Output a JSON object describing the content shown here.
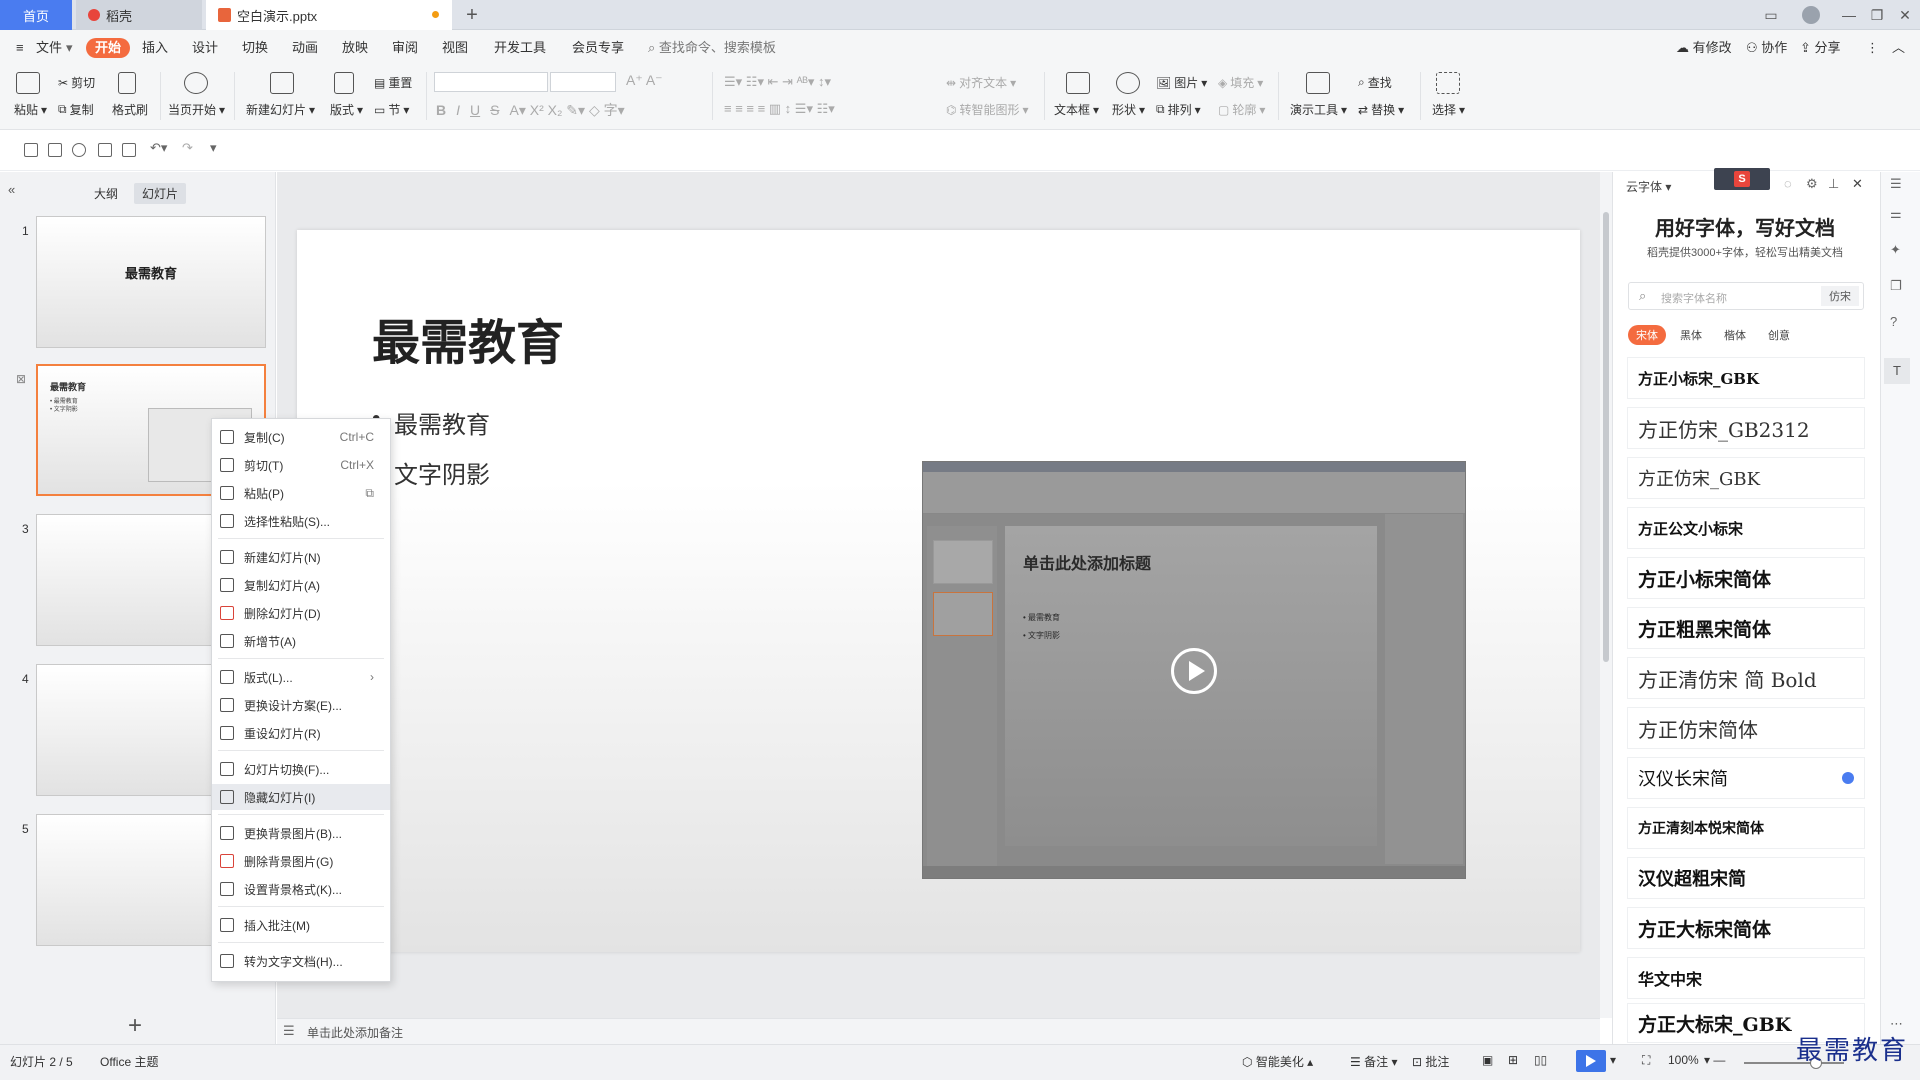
{
  "tabs": {
    "home": "首页",
    "daoke": "稻壳",
    "doc": "空白演示.pptx"
  },
  "menu": [
    "文件",
    "开始",
    "插入",
    "设计",
    "切换",
    "动画",
    "放映",
    "审阅",
    "视图",
    "开发工具",
    "会员专享"
  ],
  "search_placeholder": "查找命令、搜索模板",
  "top_right": {
    "modified": "有修改",
    "collab": "协作",
    "share": "分享"
  },
  "ribbon": {
    "paste": "粘贴",
    "cut": "剪切",
    "copy": "复制",
    "format_painter": "格式刷",
    "from_current": "当页开始",
    "new_slide": "新建幻灯片",
    "layout": "版式",
    "reset": "重置",
    "section": "节",
    "align_text": "对齐文本",
    "smart_shape": "转智能图形",
    "textbox": "文本框",
    "shape": "形状",
    "picture": "图片",
    "arrange": "排列",
    "fill": "填充",
    "outline": "轮廓",
    "present_tools": "演示工具",
    "find": "查找",
    "replace": "替换",
    "select": "选择"
  },
  "left_panel": {
    "outline_tab": "大纲",
    "slides_tab": "幻灯片",
    "slide_nums": [
      "1",
      "2",
      "3",
      "4",
      "5"
    ],
    "thumb1_title": "最需教育",
    "thumb2_title": "最需教育",
    "thumb2_b1": "• 最需教育",
    "thumb2_b2": "• 文字阴影"
  },
  "context_menu": [
    {
      "label": "复制(C)",
      "shortcut": "Ctrl+C"
    },
    {
      "label": "剪切(T)",
      "shortcut": "Ctrl+X"
    },
    {
      "label": "粘贴(P)",
      "shortcut": ""
    },
    {
      "label": "选择性粘贴(S)...",
      "shortcut": ""
    },
    {
      "label": "新建幻灯片(N)",
      "shortcut": ""
    },
    {
      "label": "复制幻灯片(A)",
      "shortcut": ""
    },
    {
      "label": "删除幻灯片(D)",
      "shortcut": ""
    },
    {
      "label": "新增节(A)",
      "shortcut": ""
    },
    {
      "label": "版式(L)...",
      "shortcut": ""
    },
    {
      "label": "更换设计方案(E)...",
      "shortcut": ""
    },
    {
      "label": "重设幻灯片(R)",
      "shortcut": ""
    },
    {
      "label": "幻灯片切换(F)...",
      "shortcut": ""
    },
    {
      "label": "隐藏幻灯片(I)",
      "shortcut": ""
    },
    {
      "label": "更换背景图片(B)...",
      "shortcut": ""
    },
    {
      "label": "删除背景图片(G)",
      "shortcut": ""
    },
    {
      "label": "设置背景格式(K)...",
      "shortcut": ""
    },
    {
      "label": "插入批注(M)",
      "shortcut": ""
    },
    {
      "label": "转为文字文档(H)...",
      "shortcut": ""
    }
  ],
  "slide": {
    "title": "最需教育",
    "bullet1": "最需教育",
    "bullet2": "文字阴影"
  },
  "video": {
    "title": "单击此处添加标题",
    "b1": "• 最需教育",
    "b2": "• 文字阴影"
  },
  "notes_placeholder": "单击此处添加备注",
  "font_panel": {
    "header": "云字体",
    "headline": "用好字体，写好文档",
    "subline": "稻壳提供3000+字体，轻松写出精美文档",
    "search_placeholder": "搜索字体名称",
    "search_tag": "仿宋",
    "categories": [
      "宋体",
      "黑体",
      "楷体",
      "创意"
    ],
    "fonts": [
      "方正小标宋_GBK",
      "方正仿宋_GB2312",
      "方正仿宋_GBK",
      "方正公文小标宋",
      "方正小标宋简体",
      "方正粗黑宋简体",
      "方正清仿宋 简 Bold",
      "方正仿宋简体",
      "汉仪长宋简",
      "方正清刻本悦宋简体",
      "汉仪超粗宋简",
      "方正大标宋简体",
      "华文中宋",
      "方正大标宋_GBK"
    ]
  },
  "status": {
    "slide_info": "幻灯片 2 / 5",
    "theme": "Office 主题",
    "smart": "智能美化",
    "notes": "备注",
    "comment": "批注",
    "zoom": "100%"
  },
  "watermark": "最需教育",
  "colors": {
    "accent": "#f46b3f",
    "home_tab": "#4a7cf0",
    "selection": "#f4803e"
  }
}
